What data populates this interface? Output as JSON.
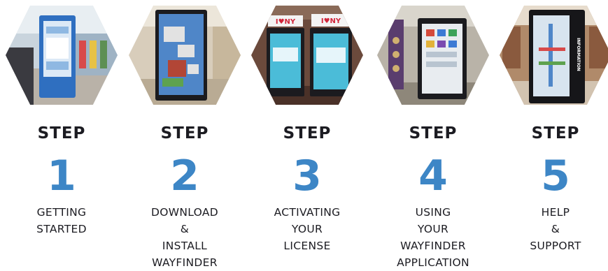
{
  "steps": [
    {
      "step_label": "STEP",
      "number": "1",
      "caption_lines": [
        "GETTING",
        "STARTED"
      ],
      "photo": "kiosk-in-store-photo"
    },
    {
      "step_label": "STEP",
      "number": "2",
      "caption_lines": [
        "DOWNLOAD",
        "&",
        "INSTALL",
        "WAYFINDER"
      ],
      "photo": "kiosk-mall-map-photo"
    },
    {
      "step_label": "STEP",
      "number": "3",
      "caption_lines": [
        "ACTIVATING",
        "YOUR",
        "LICENSE"
      ],
      "photo": "kiosk-pair-photo",
      "sign_text": "I♥NY"
    },
    {
      "step_label": "STEP",
      "number": "4",
      "caption_lines": [
        "USING",
        "YOUR",
        "WAYFINDER",
        "APPLICATION"
      ],
      "photo": "kiosk-directory-photo"
    },
    {
      "step_label": "STEP",
      "number": "5",
      "caption_lines": [
        "HELP",
        "&",
        "SUPPORT"
      ],
      "photo": "kiosk-information-photo",
      "sign_text": "INFORMATION"
    }
  ],
  "colors": {
    "number_blue": "#3d86c6",
    "text_dark": "#1c1c22"
  }
}
